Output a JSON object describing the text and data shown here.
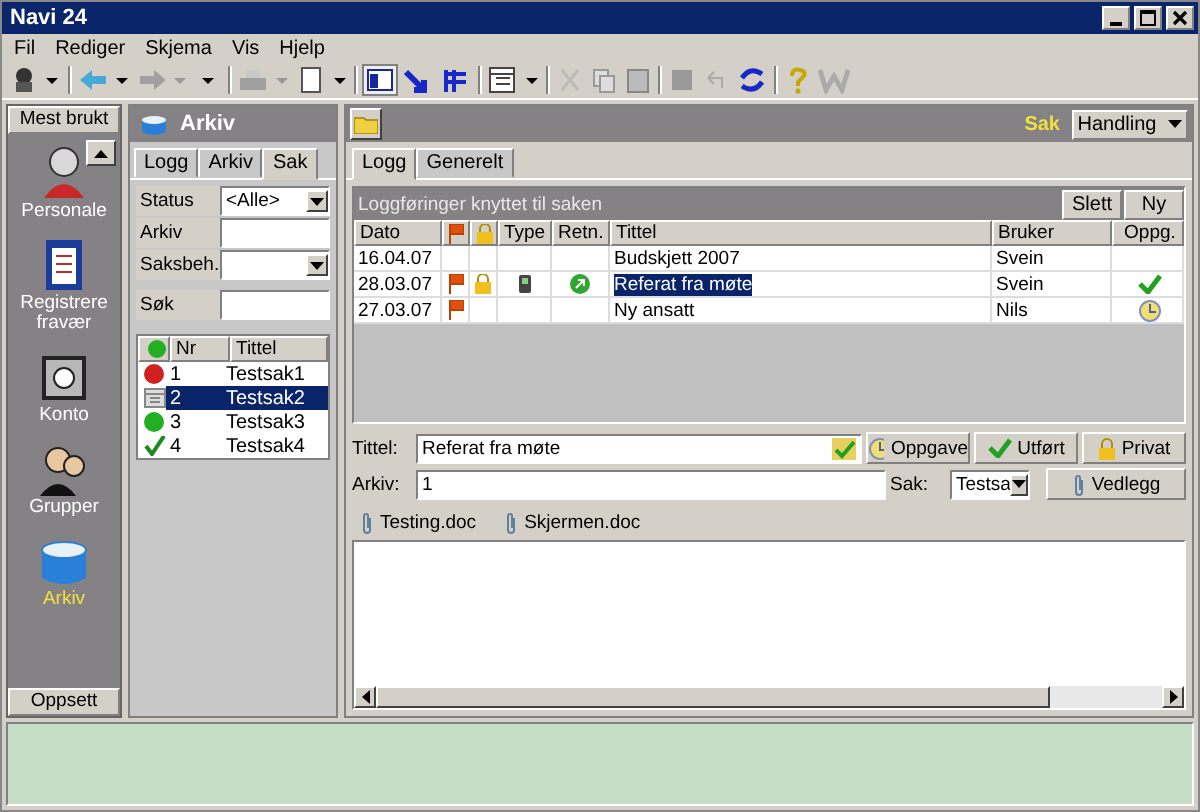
{
  "window": {
    "title": "Navi 24"
  },
  "menu": [
    "Fil",
    "Rediger",
    "Skjema",
    "Vis",
    "Hjelp"
  ],
  "nav": {
    "header": "Mest brukt",
    "footer": "Oppsett",
    "items": [
      {
        "label": "Personale",
        "kind": "person",
        "selected": false
      },
      {
        "label": "Registrere fravær",
        "kind": "clipboard",
        "selected": false
      },
      {
        "label": "Konto",
        "kind": "safe",
        "selected": false
      },
      {
        "label": "Grupper",
        "kind": "group",
        "selected": false
      },
      {
        "label": "Arkiv",
        "kind": "archive",
        "selected": true
      }
    ]
  },
  "archive_panel": {
    "title": "Arkiv",
    "tabs": [
      {
        "label": "Logg",
        "selected": false
      },
      {
        "label": "Arkiv",
        "selected": false
      },
      {
        "label": "Sak",
        "selected": true
      }
    ],
    "filters": [
      {
        "label": "Status",
        "kind": "dropdown",
        "value": "<Alle>"
      },
      {
        "label": "Arkiv",
        "kind": "text"
      },
      {
        "label": "Saksbeh.",
        "kind": "dropdown"
      }
    ],
    "search": {
      "label": "Søk"
    },
    "cases": {
      "columns": [
        "Nr",
        "Tittel"
      ],
      "rows": [
        {
          "kind": "stopped",
          "nr": "1",
          "title": "Testsak1",
          "selected": false
        },
        {
          "kind": "scheduled",
          "nr": "2",
          "title": "Testsak2",
          "selected": true
        },
        {
          "kind": "active",
          "nr": "3",
          "title": "Testsak3",
          "selected": false
        },
        {
          "kind": "done",
          "nr": "4",
          "title": "Testsak4",
          "selected": false
        }
      ]
    }
  },
  "case_panel": {
    "badge": "Sak",
    "action_button": "Handling",
    "tabs": [
      {
        "label": "Logg",
        "selected": true
      },
      {
        "label": "Generelt",
        "selected": false
      }
    ],
    "log": {
      "title": "Loggføringer knyttet til saken",
      "buttons": [
        "Slett",
        "Ny"
      ],
      "columns": [
        "Dato",
        "Type",
        "Retn.",
        "Tittel",
        "Bruker",
        "Oppg."
      ],
      "rows": [
        {
          "date": "16.04.07",
          "flagged": false,
          "locked": false,
          "phone": false,
          "outgoing": false,
          "title": "Budskjett 2007",
          "user": "Svein",
          "task_done": false,
          "task_open": false,
          "selected": false
        },
        {
          "date": "28.03.07",
          "flagged": true,
          "locked": true,
          "phone": true,
          "outgoing": true,
          "title": "Referat fra møte",
          "user": "Svein",
          "task_done": true,
          "task_open": false,
          "selected": true
        },
        {
          "date": "27.03.07",
          "flagged": true,
          "locked": false,
          "phone": false,
          "outgoing": false,
          "title": "Ny ansatt",
          "user": "Nils",
          "task_done": false,
          "task_open": true,
          "selected": false
        }
      ]
    },
    "form": {
      "title_label": "Tittel:",
      "title_value": "Referat fra møte",
      "task_button": "Oppgave",
      "done_button": "Utført",
      "private_button": "Privat",
      "archive_label": "Arkiv:",
      "archive_value": "1",
      "case_label": "Sak:",
      "case_value": "Testsa",
      "attach_button": "Vedlegg"
    },
    "attachments": [
      "Testing.doc",
      "Skjermen.doc"
    ]
  }
}
